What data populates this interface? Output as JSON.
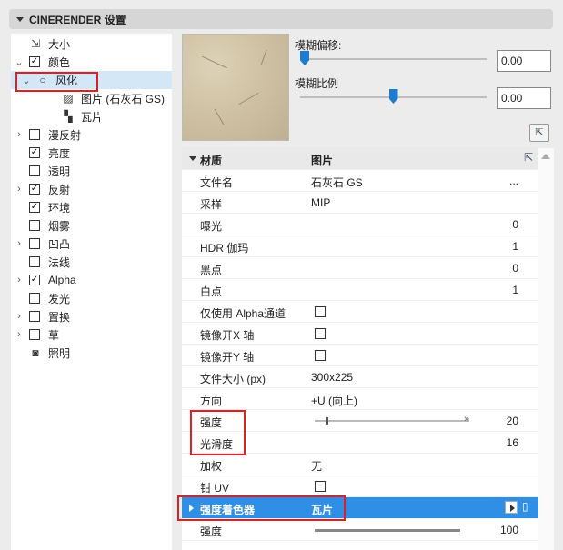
{
  "header": {
    "title": "CINERENDER 设置"
  },
  "tree": [
    {
      "label": "大小",
      "exp": "",
      "cb": null,
      "icon": "⇲",
      "icon_name": "size-icon",
      "indent": 0
    },
    {
      "label": "颜色",
      "exp": "⌄",
      "cb": true,
      "icon": null,
      "indent": 0
    },
    {
      "label": "风化",
      "exp": "⌄",
      "cb": null,
      "icon": "○",
      "icon_name": "shader-circle-icon",
      "indent": 1,
      "selected": true
    },
    {
      "label": "图片 (石灰石 GS)",
      "exp": "",
      "cb": null,
      "icon": "▨",
      "icon_name": "image-icon",
      "indent": 2
    },
    {
      "label": "瓦片",
      "exp": "",
      "cb": null,
      "icon": "▚",
      "icon_name": "tile-icon",
      "indent": 2
    },
    {
      "label": "漫反射",
      "exp": "›",
      "cb": false,
      "icon": null,
      "indent": 0
    },
    {
      "label": "亮度",
      "exp": "",
      "cb": true,
      "icon": null,
      "indent": 0
    },
    {
      "label": "透明",
      "exp": "",
      "cb": false,
      "icon": null,
      "indent": 0
    },
    {
      "label": "反射",
      "exp": "›",
      "cb": true,
      "icon": null,
      "indent": 0
    },
    {
      "label": "环境",
      "exp": "",
      "cb": true,
      "icon": null,
      "indent": 0
    },
    {
      "label": "烟雾",
      "exp": "",
      "cb": false,
      "icon": null,
      "indent": 0
    },
    {
      "label": "凹凸",
      "exp": "›",
      "cb": false,
      "icon": null,
      "indent": 0
    },
    {
      "label": "法线",
      "exp": "",
      "cb": false,
      "icon": null,
      "indent": 0
    },
    {
      "label": "Alpha",
      "exp": "›",
      "cb": true,
      "icon": null,
      "indent": 0
    },
    {
      "label": "发光",
      "exp": "",
      "cb": false,
      "icon": null,
      "indent": 0
    },
    {
      "label": "置换",
      "exp": "›",
      "cb": false,
      "icon": null,
      "indent": 0
    },
    {
      "label": "草",
      "exp": "›",
      "cb": false,
      "icon": null,
      "indent": 0
    },
    {
      "label": "照明",
      "exp": "",
      "cb": null,
      "icon": "◙",
      "icon_name": "lighting-icon",
      "indent": 0
    }
  ],
  "blur_offset": {
    "label": "模糊偏移:",
    "value": "0.00",
    "level": 0.0
  },
  "blur_scale": {
    "label": "模糊比例",
    "value": "0.00",
    "level": 0.5
  },
  "table": {
    "header": {
      "c1": "材质",
      "c2": "图片"
    },
    "rows": [
      {
        "c1": "文件名",
        "c2": "石灰石 GS",
        "cv": "..."
      },
      {
        "c1": "采样",
        "c2": "MIP",
        "cv": ""
      },
      {
        "c1": "曝光",
        "c2": "",
        "cv": "0"
      },
      {
        "c1": "HDR 伽玛",
        "c2": "",
        "cv": "1"
      },
      {
        "c1": "黑点",
        "c2": "",
        "cv": "0"
      },
      {
        "c1": "白点",
        "c2": "",
        "cv": "1"
      },
      {
        "c1": "仅使用 Alpha通道",
        "c2": "",
        "cv": "",
        "checkbox": true
      },
      {
        "c1": "镜像开X 轴",
        "c2": "",
        "cv": "",
        "checkbox": true
      },
      {
        "c1": "镜像开Y 轴",
        "c2": "",
        "cv": "",
        "checkbox": true
      },
      {
        "c1": "文件大小 (px)",
        "c2": "300x225",
        "cv": ""
      },
      {
        "c1": "方向",
        "c2": "+U (向上)",
        "cv": ""
      },
      {
        "c1": "强度",
        "c2": "",
        "cv": "20",
        "slider": true
      },
      {
        "c1": "光滑度",
        "c2": "",
        "cv": "16"
      },
      {
        "c1": "加权",
        "c2": "无",
        "cv": ""
      },
      {
        "c1": "钳 UV",
        "c2": "",
        "cv": "",
        "checkbox": true
      },
      {
        "c1": "强度着色器",
        "c2": "瓦片",
        "cv": "",
        "highlight": true
      },
      {
        "c1": "强度",
        "c2": "",
        "cv": "100",
        "slider2": true
      }
    ]
  }
}
